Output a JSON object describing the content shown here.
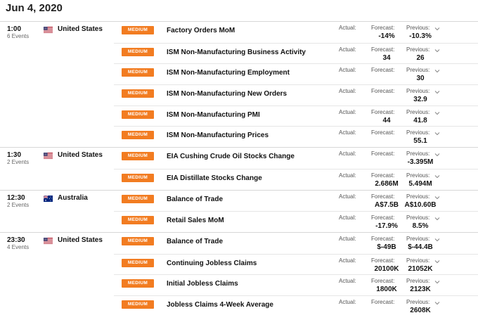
{
  "date_header": "Jun 4, 2020",
  "columns": {
    "actual": "Actual:",
    "forecast": "Forecast:",
    "previous": "Previous:"
  },
  "groups": [
    {
      "time": "1:00",
      "events_count": "6 Events",
      "country": "United States",
      "flag": "us-flag-icon",
      "rows": [
        {
          "impact": "MEDIUM",
          "name": "Factory Orders MoM",
          "forecast": "-14%",
          "previous": "-10.3%"
        },
        {
          "impact": "MEDIUM",
          "name": "ISM Non-Manufacturing Business Activity",
          "forecast": "34",
          "previous": "26"
        },
        {
          "impact": "MEDIUM",
          "name": "ISM Non-Manufacturing Employment",
          "forecast": "",
          "previous": "30"
        },
        {
          "impact": "MEDIUM",
          "name": "ISM Non-Manufacturing New Orders",
          "forecast": "",
          "previous": "32.9"
        },
        {
          "impact": "MEDIUM",
          "name": "ISM Non-Manufacturing PMI",
          "forecast": "44",
          "previous": "41.8"
        },
        {
          "impact": "MEDIUM",
          "name": "ISM Non-Manufacturing Prices",
          "forecast": "",
          "previous": "55.1"
        }
      ]
    },
    {
      "time": "1:30",
      "events_count": "2 Events",
      "country": "United States",
      "flag": "us-flag-icon",
      "rows": [
        {
          "impact": "MEDIUM",
          "name": "EIA Cushing Crude Oil Stocks Change",
          "forecast": "",
          "previous": "-3.395M"
        },
        {
          "impact": "MEDIUM",
          "name": "EIA Distillate Stocks Change",
          "forecast": "2.686M",
          "previous": "5.494M"
        }
      ]
    },
    {
      "time": "12:30",
      "events_count": "2 Events",
      "country": "Australia",
      "flag": "australia-flag-icon",
      "rows": [
        {
          "impact": "MEDIUM",
          "name": "Balance of Trade",
          "forecast": "A$7.5B",
          "previous": "A$10.60B"
        },
        {
          "impact": "MEDIUM",
          "name": "Retail Sales MoM",
          "forecast": "-17.9%",
          "previous": "8.5%"
        }
      ]
    },
    {
      "time": "23:30",
      "events_count": "4 Events",
      "country": "United States",
      "flag": "us-flag-icon",
      "rows": [
        {
          "impact": "MEDIUM",
          "name": "Balance of Trade",
          "forecast": "$-49B",
          "previous": "$-44.4B"
        },
        {
          "impact": "MEDIUM",
          "name": "Continuing Jobless Claims",
          "forecast": "20100K",
          "previous": "21052K"
        },
        {
          "impact": "MEDIUM",
          "name": "Initial Jobless Claims",
          "forecast": "1800K",
          "previous": "2123K"
        },
        {
          "impact": "MEDIUM",
          "name": "Jobless Claims 4-Week Average",
          "forecast": "",
          "previous": "2608K"
        }
      ]
    }
  ],
  "colors": {
    "impact_medium": "#f27c21",
    "divider": "#d7d7d7"
  }
}
